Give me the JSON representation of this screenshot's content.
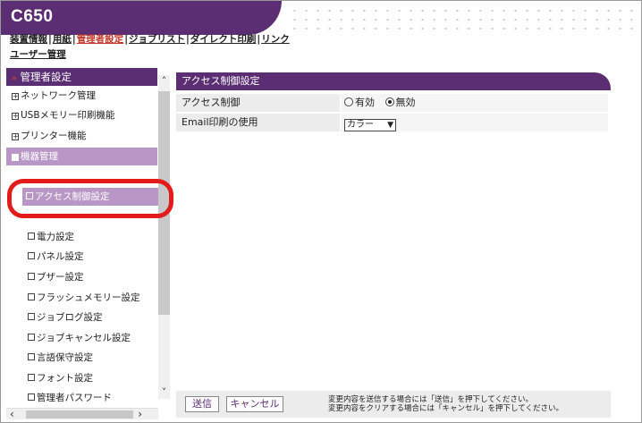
{
  "header": {
    "title": "C650",
    "nav": [
      {
        "label": "装置情報",
        "active": false
      },
      {
        "label": "用紙",
        "active": false
      },
      {
        "label": "管理者設定",
        "active": true
      },
      {
        "label": "ジョブリスト",
        "active": false
      },
      {
        "label": "ダイレクト印刷",
        "active": false
      },
      {
        "label": "リンク",
        "active": false
      }
    ],
    "subnav_label": "ユーザー管理"
  },
  "sidebar": {
    "heading": "管理者設定",
    "groups": [
      {
        "label": "ネットワーク管理"
      },
      {
        "label": "USBメモリー印刷機能"
      },
      {
        "label": "プリンター機能"
      },
      {
        "label": "機器管理"
      }
    ],
    "subitems": [
      {
        "label": "アクセス制御設定"
      },
      {
        "label": "電力設定"
      },
      {
        "label": "パネル設定"
      },
      {
        "label": "ブザー設定"
      },
      {
        "label": "フラッシュメモリー設定"
      },
      {
        "label": "ジョブログ設定"
      },
      {
        "label": "ジョブキャンセル設定"
      },
      {
        "label": "言語保守設定"
      },
      {
        "label": "フォント設定"
      },
      {
        "label": "管理者パスワード"
      }
    ]
  },
  "main": {
    "heading": "アクセス制御設定",
    "access_label": "アクセス制御",
    "access_options": [
      "有効",
      "無効"
    ],
    "access_selected": "無効",
    "email_label": "Email印刷の使用",
    "email_value": "カラー"
  },
  "footer": {
    "submit": "送信",
    "cancel": "キャンセル",
    "note1": "変更内容を送信する場合には「送信」を押下してください。",
    "note2": "変更内容をクリアする場合には「キャンセル」を押下してください。"
  },
  "colors": {
    "brand": "#5b2d72",
    "highlight": "#b897c6",
    "annotation_ring": "#e31b1b"
  }
}
